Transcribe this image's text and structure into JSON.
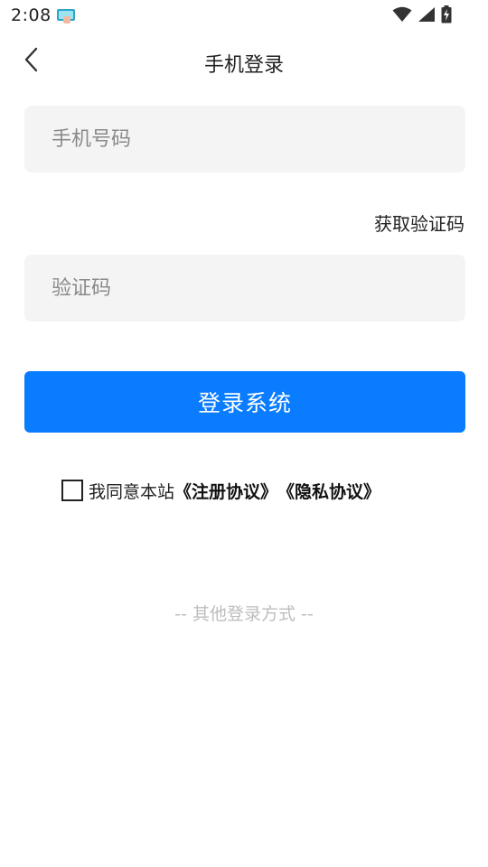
{
  "status_bar": {
    "time": "2:08"
  },
  "header": {
    "title": "手机登录"
  },
  "form": {
    "phone_placeholder": "手机号码",
    "phone_value": "",
    "get_code_label": "获取验证码",
    "code_placeholder": "验证码",
    "code_value": "",
    "login_label": "登录系统"
  },
  "agreement": {
    "checked": false,
    "prefix": "我同意本站",
    "register_link": "《注册协议》",
    "privacy_link": "《隐私协议》"
  },
  "other_login": {
    "label": "-- 其他登录方式 --"
  },
  "colors": {
    "accent": "#0a7cff",
    "input_bg": "#f4f4f4",
    "muted_text": "#bdbdbd"
  }
}
